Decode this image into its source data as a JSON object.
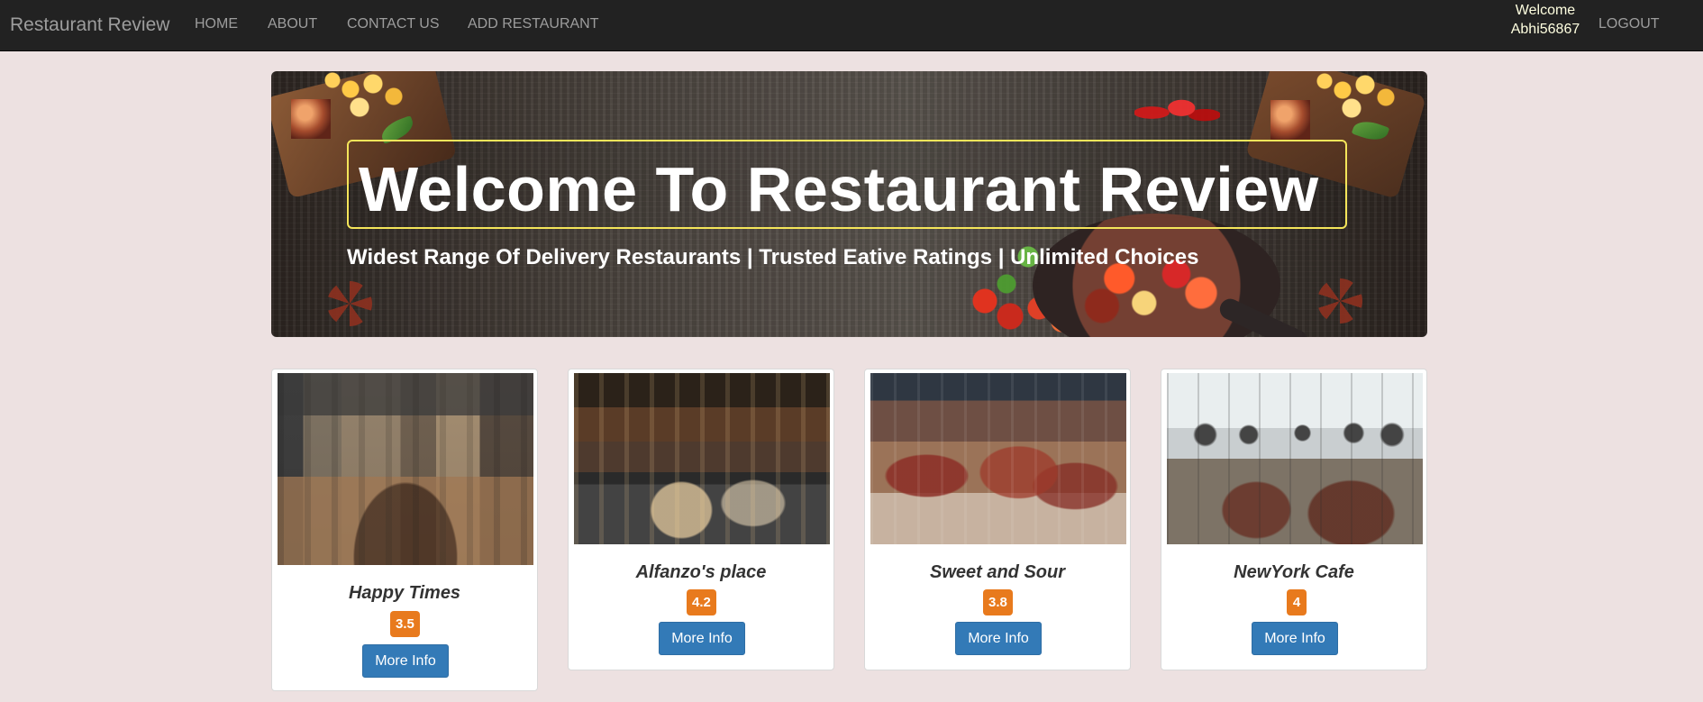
{
  "navbar": {
    "brand": "Restaurant Review",
    "links": {
      "home": "HOME",
      "about": "ABOUT",
      "contact": "CONTACT US",
      "add_restaurant": "ADD RESTAURANT"
    },
    "welcome_label": "Welcome",
    "username": "Abhi56867",
    "logout": "LOGOUT"
  },
  "hero": {
    "title": "Welcome To Restaurant Review",
    "subtitle": "Widest Range Of Delivery Restaurants | Trusted Eative Ratings | Unlimited Choices"
  },
  "restaurants": [
    {
      "name": "Happy Times",
      "rating": "3.5",
      "button": "More Info"
    },
    {
      "name": "Alfanzo's place",
      "rating": "4.2",
      "button": "More Info"
    },
    {
      "name": "Sweet and Sour",
      "rating": "3.8",
      "button": "More Info"
    },
    {
      "name": "NewYork Cafe",
      "rating": "4",
      "button": "More Info"
    }
  ],
  "colors": {
    "page_background": "#ede1e1",
    "navbar_background": "#222222",
    "rating_badge": "#e87a1d",
    "button_primary": "#337ab7",
    "hero_outline": "#f4e55a"
  }
}
